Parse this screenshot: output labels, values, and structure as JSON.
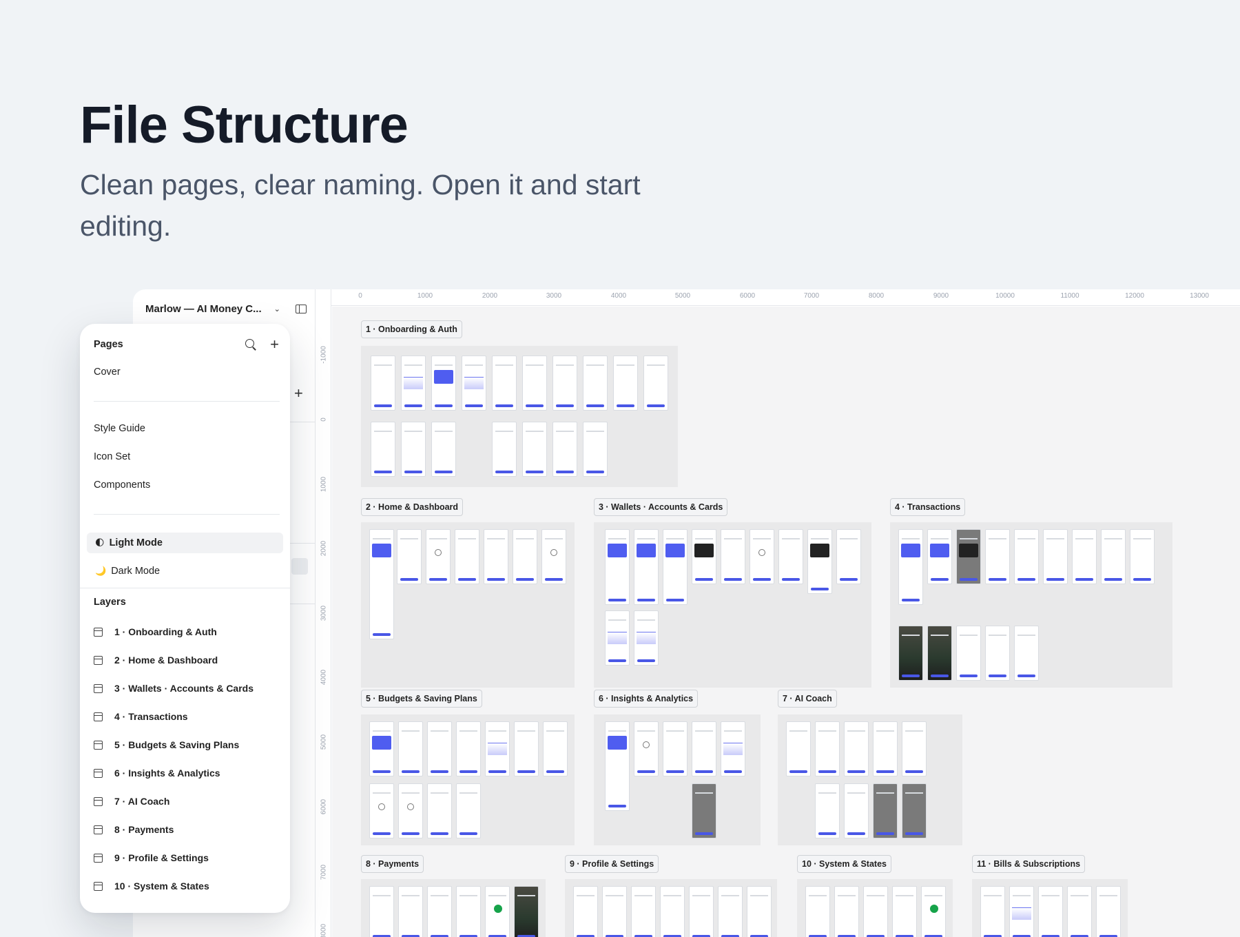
{
  "hero": {
    "title": "File Structure",
    "subtitle": "Clean pages, clear naming. Open it and start editing."
  },
  "file": {
    "name": "Marlow — AI Money C..."
  },
  "rulers": {
    "horizontal": [
      "0",
      "1000",
      "2000",
      "3000",
      "4000",
      "5000",
      "6000",
      "7000",
      "8000",
      "9000",
      "10000",
      "11000",
      "12000",
      "13000"
    ],
    "vertical": [
      "-1000",
      "0",
      "1000",
      "2000",
      "3000",
      "4000",
      "5000",
      "6000",
      "7000",
      "8000"
    ]
  },
  "pages_panel": {
    "title": "Pages",
    "pages": [
      "Cover",
      "Style Guide",
      "Icon Set",
      "Components"
    ],
    "modes": [
      {
        "emoji": "🌓",
        "label": "Light Mode",
        "active": true
      },
      {
        "emoji": "🌙",
        "label": "Dark Mode",
        "active": false
      }
    ]
  },
  "layers_panel": {
    "title": "Layers",
    "layers": [
      "1 · Onboarding & Auth",
      "2 · Home & Dashboard",
      "3 · Wallets · Accounts & Cards",
      "4 · Transactions",
      "5 · Budgets & Saving Plans",
      "6 · Insights & Analytics",
      "7 · AI Coach",
      "8 · Payments",
      "9 · Profile & Settings",
      "10 · System & States"
    ]
  },
  "canvas_sections": [
    "1 · Onboarding & Auth",
    "2 · Home & Dashboard",
    "3 · Wallets · Accounts & Cards",
    "4 · Transactions",
    "5 · Budgets & Saving Plans",
    "6 · Insights & Analytics",
    "7 · AI Coach",
    "8 · Payments",
    "9 · Profile & Settings",
    "10 · System & States",
    "11 · Bills & Subscriptions"
  ]
}
